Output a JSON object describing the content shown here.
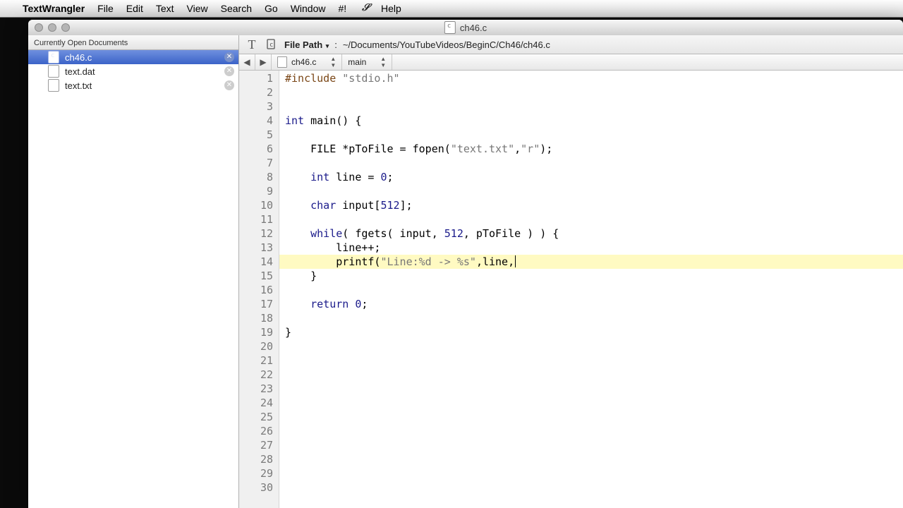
{
  "menubar": {
    "app": "TextWrangler",
    "items": [
      "File",
      "Edit",
      "Text",
      "View",
      "Search",
      "Go",
      "Window",
      "#!"
    ],
    "help": "Help"
  },
  "window": {
    "title": "ch46.c"
  },
  "sidebar": {
    "header": "Currently Open Documents",
    "files": [
      {
        "name": "ch46.c",
        "active": true,
        "kind": "c"
      },
      {
        "name": "text.dat",
        "active": false,
        "kind": "txt"
      },
      {
        "name": "text.txt",
        "active": false,
        "kind": "txt"
      }
    ]
  },
  "pathbar": {
    "label": "File Path",
    "sep": ":",
    "path": "~/Documents/YouTubeVideos/BeginC/Ch46/ch46.c"
  },
  "navbar": {
    "file": "ch46.c",
    "symbol": "main"
  },
  "code": {
    "highlight_line": 14,
    "total_lines": 30,
    "lines": [
      {
        "n": 1,
        "tokens": [
          {
            "c": "pp",
            "t": "#include "
          },
          {
            "c": "str",
            "t": "\"stdio.h\""
          }
        ]
      },
      {
        "n": 2,
        "tokens": []
      },
      {
        "n": 3,
        "tokens": []
      },
      {
        "n": 4,
        "tokens": [
          {
            "c": "kw",
            "t": "int"
          },
          {
            "t": " main() {"
          }
        ]
      },
      {
        "n": 5,
        "tokens": []
      },
      {
        "n": 6,
        "tokens": [
          {
            "t": "    FILE *pToFile = fopen("
          },
          {
            "c": "str",
            "t": "\"text.txt\""
          },
          {
            "t": ","
          },
          {
            "c": "str",
            "t": "\"r\""
          },
          {
            "t": ");"
          }
        ]
      },
      {
        "n": 7,
        "tokens": []
      },
      {
        "n": 8,
        "tokens": [
          {
            "t": "    "
          },
          {
            "c": "kw",
            "t": "int"
          },
          {
            "t": " line = "
          },
          {
            "c": "num",
            "t": "0"
          },
          {
            "t": ";"
          }
        ]
      },
      {
        "n": 9,
        "tokens": []
      },
      {
        "n": 10,
        "tokens": [
          {
            "t": "    "
          },
          {
            "c": "kw",
            "t": "char"
          },
          {
            "t": " input["
          },
          {
            "c": "num",
            "t": "512"
          },
          {
            "t": "];"
          }
        ]
      },
      {
        "n": 11,
        "tokens": []
      },
      {
        "n": 12,
        "tokens": [
          {
            "t": "    "
          },
          {
            "c": "kw",
            "t": "while"
          },
          {
            "t": "( fgets( input, "
          },
          {
            "c": "num",
            "t": "512"
          },
          {
            "t": ", pToFile ) ) {"
          }
        ]
      },
      {
        "n": 13,
        "tokens": [
          {
            "t": "        line++;"
          }
        ]
      },
      {
        "n": 14,
        "tokens": [
          {
            "t": "        printf("
          },
          {
            "c": "str",
            "t": "\"Line:%d -> %s\""
          },
          {
            "t": ",line,"
          }
        ],
        "cursor": true
      },
      {
        "n": 15,
        "tokens": [
          {
            "t": "    }"
          }
        ]
      },
      {
        "n": 16,
        "tokens": []
      },
      {
        "n": 17,
        "tokens": [
          {
            "t": "    "
          },
          {
            "c": "kw",
            "t": "return"
          },
          {
            "t": " "
          },
          {
            "c": "num",
            "t": "0"
          },
          {
            "t": ";"
          }
        ]
      },
      {
        "n": 18,
        "tokens": []
      },
      {
        "n": 19,
        "tokens": [
          {
            "t": "}"
          }
        ]
      },
      {
        "n": 20,
        "tokens": []
      },
      {
        "n": 21,
        "tokens": []
      },
      {
        "n": 22,
        "tokens": []
      },
      {
        "n": 23,
        "tokens": []
      },
      {
        "n": 24,
        "tokens": []
      },
      {
        "n": 25,
        "tokens": []
      },
      {
        "n": 26,
        "tokens": []
      },
      {
        "n": 27,
        "tokens": []
      },
      {
        "n": 28,
        "tokens": []
      },
      {
        "n": 29,
        "tokens": []
      },
      {
        "n": 30,
        "tokens": []
      }
    ]
  }
}
